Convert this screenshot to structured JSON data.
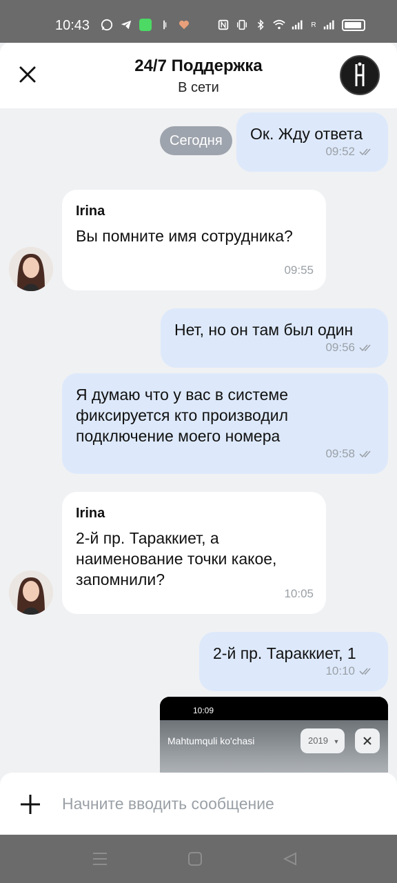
{
  "status_bar": {
    "time": "10:43",
    "left_icons": [
      "whatsapp-icon",
      "telegram-icon",
      "spotify-icon",
      "signal-icon",
      "heart-icon"
    ],
    "right_icons": [
      "nfc-icon",
      "vibrate-icon",
      "bluetooth-icon",
      "wifi-icon",
      "signal-bars-icon",
      "battery-icon"
    ],
    "roaming_label": "R"
  },
  "header": {
    "title": "24/7 Поддержка",
    "status": "В сети",
    "logo_icon": "brand-logo-icon"
  },
  "chat": {
    "date_chip": "Сегодня",
    "messages": [
      {
        "direction": "out",
        "text": "Ок. Жду ответа",
        "time": "09:52",
        "read": true
      },
      {
        "direction": "in",
        "sender": "Irina",
        "text": "Вы помните имя сотрудника?",
        "time": "09:55"
      },
      {
        "direction": "out",
        "text": "Нет, но он там был один",
        "time": "09:56",
        "read": true
      },
      {
        "direction": "out",
        "text": "Я думаю что у вас в системе фиксируется кто производил подключение моего номера",
        "time": "09:58",
        "read": true
      },
      {
        "direction": "in",
        "sender": "Irina",
        "text": "2-й пр. Тараккиет, а наименование точки какое, запомнили?",
        "time": "10:05"
      },
      {
        "direction": "out",
        "text": "2-й пр. Тараккиет, 1",
        "time": "10:10",
        "read": true
      }
    ],
    "image_preview": {
      "status_time": "10:09",
      "title": "Mahtumquli ko'chasi",
      "year": "2019"
    }
  },
  "composer": {
    "placeholder": "Начните вводить сообщение"
  },
  "colors": {
    "outgoing_bubble": "#dde9fb",
    "incoming_bubble": "#ffffff",
    "background": "#f0f1f3",
    "system_bars": "#6b6b6b"
  }
}
